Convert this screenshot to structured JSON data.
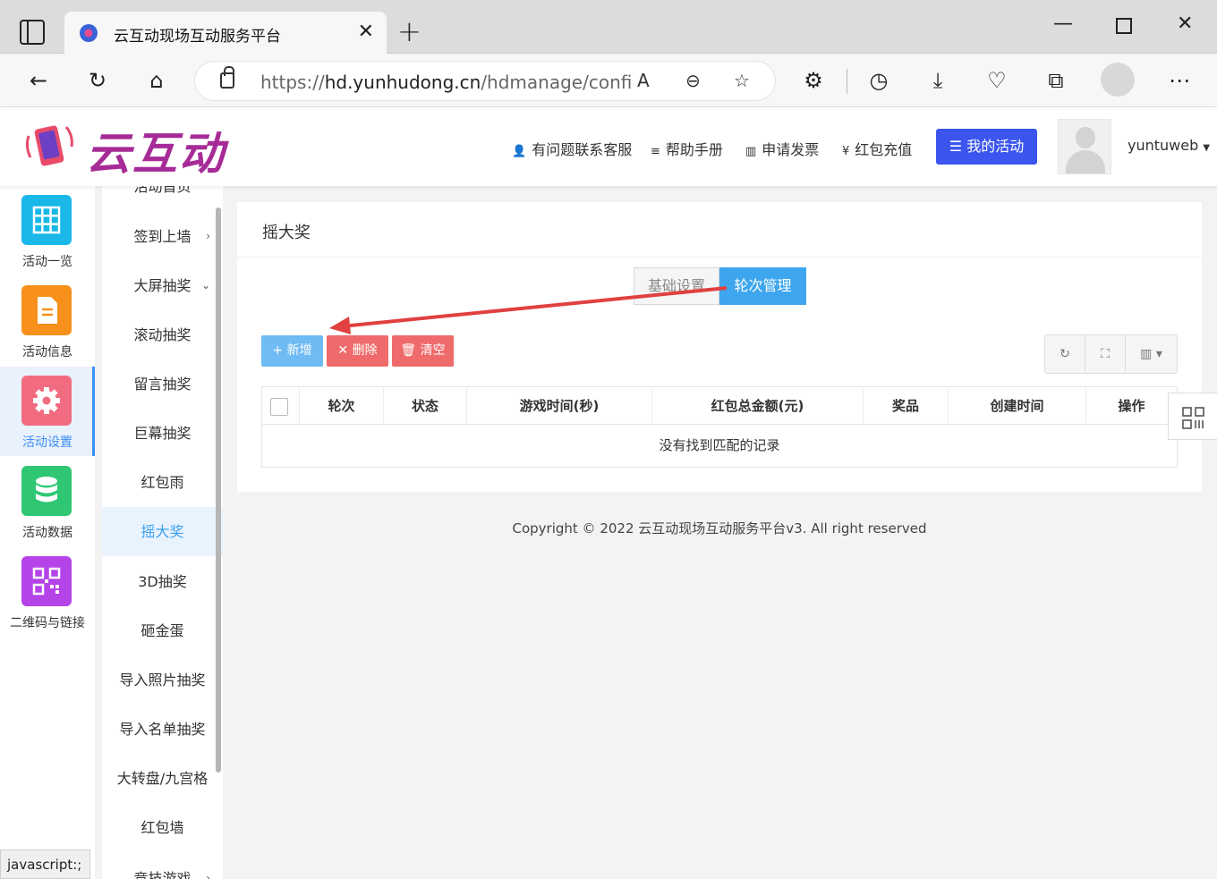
{
  "browser": {
    "tab_title": "云互动现场互动服务平台",
    "url_prefix": "https://",
    "url_host": "hd.yunhudong.cn",
    "url_path": "/hdmanage/confi...",
    "status_text": "javascript:;"
  },
  "header": {
    "logo_text": "云互动",
    "nav": [
      "有问题联系客服",
      "帮助手册",
      "申请发票",
      "红包充值"
    ],
    "my_activity": "我的活动",
    "username": "yuntuweb"
  },
  "sidebar": {
    "items": [
      {
        "label": "活动一览",
        "color": "#19b8e8",
        "icon": "grid-icon"
      },
      {
        "label": "活动信息",
        "color": "#f8901c",
        "icon": "document-icon"
      },
      {
        "label": "活动设置",
        "color": "#f16c80",
        "icon": "gear-icon"
      },
      {
        "label": "活动数据",
        "color": "#2fc774",
        "icon": "database-icon"
      },
      {
        "label": "二维码与链接",
        "color": "#b443e8",
        "icon": "qrcode-icon"
      }
    ]
  },
  "submenu": {
    "items": [
      "活动首页",
      "签到上墙",
      "大屏抽奖",
      "滚动抽奖",
      "留言抽奖",
      "巨幕抽奖",
      "红包雨",
      "摇大奖",
      "3D抽奖",
      "砸金蛋",
      "导入照片抽奖",
      "导入名单抽奖",
      "大转盘/九宫格",
      "红包墙",
      "竞技游戏"
    ]
  },
  "panel": {
    "title": "摇大奖",
    "segments": [
      "基础设置",
      "轮次管理"
    ],
    "buttons": {
      "add": "新增",
      "delete": "删除",
      "clear": "清空"
    },
    "columns": [
      "轮次",
      "状态",
      "游戏时间(秒)",
      "红包总金额(元)",
      "奖品",
      "创建时间",
      "操作"
    ],
    "empty_text": "没有找到匹配的记录"
  },
  "footer": {
    "copyright": "Copyright © 2022 云互动现场互动服务平台v3. All right reserved"
  }
}
